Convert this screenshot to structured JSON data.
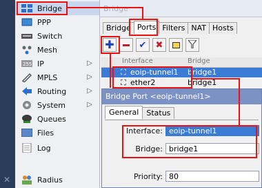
{
  "sidebar": {
    "items": [
      {
        "label": "Bridge",
        "icon": "bridge-icon",
        "submenu": false
      },
      {
        "label": "PPP",
        "icon": "ppp-icon",
        "submenu": false
      },
      {
        "label": "Switch",
        "icon": "switch-icon",
        "submenu": false
      },
      {
        "label": "Mesh",
        "icon": "mesh-icon",
        "submenu": false
      },
      {
        "label": "IP",
        "icon": "ip-icon",
        "submenu": true
      },
      {
        "label": "MPLS",
        "icon": "mpls-icon",
        "submenu": true
      },
      {
        "label": "Routing",
        "icon": "routing-icon",
        "submenu": true
      },
      {
        "label": "System",
        "icon": "system-icon",
        "submenu": true
      },
      {
        "label": "Queues",
        "icon": "queues-icon",
        "submenu": false
      },
      {
        "label": "Files",
        "icon": "files-icon",
        "submenu": false
      },
      {
        "label": "Log",
        "icon": "log-icon",
        "submenu": false
      },
      {
        "label": "Radius",
        "icon": "radius-icon",
        "submenu": false
      }
    ],
    "submenu_arrow": "▷"
  },
  "window": {
    "title": "Bridge",
    "tabs": [
      "Bridge",
      "Ports",
      "Filters",
      "NAT",
      "Hosts"
    ],
    "active_tab": "Ports",
    "toolbar": [
      "add-icon",
      "remove-icon",
      "enable-icon",
      "disable-icon",
      "comment-icon",
      "filter-icon"
    ],
    "columns": [
      "Interface",
      "Bridge"
    ],
    "rows": [
      {
        "interface": "eoip-tunnel1",
        "bridge": "bridge1",
        "selected": true
      },
      {
        "interface": "ether2",
        "bridge": "bridge1",
        "selected": false
      }
    ]
  },
  "dialog": {
    "title": "Bridge Port <eoip-tunnel1>",
    "tabs": [
      "General",
      "Status"
    ],
    "fields": {
      "interface_label": "Interface:",
      "interface_value": "eoip-tunnel1",
      "bridge_label": "Bridge:",
      "bridge_value": "bridge1",
      "priority_label": "Priority:",
      "priority_value": "80"
    }
  },
  "colors": {
    "highlight": "#e11111",
    "selection": "#3a7bd5",
    "dialog_title": "#7c92c4"
  }
}
